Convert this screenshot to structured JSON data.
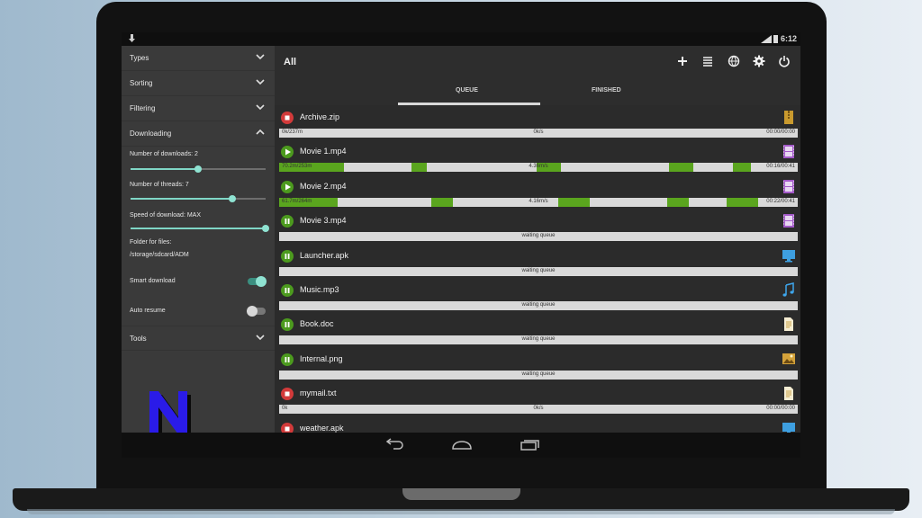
{
  "statusbar": {
    "time": "6:12"
  },
  "sidebar": {
    "sections": [
      {
        "label": "Types"
      },
      {
        "label": "Sorting"
      },
      {
        "label": "Filtering"
      },
      {
        "label": "Downloading"
      }
    ],
    "downloads_label": "Number of downloads: 2",
    "downloads_level": 0.5,
    "threads_label": "Number of threads: 7",
    "threads_level": 0.75,
    "speed_label": "Speed of download: MAX",
    "speed_level": 1.0,
    "folder_label": "Folder for files:",
    "folder_path": "/storage/sdcard/ADM",
    "smart_label": "Smart download",
    "smart_on": true,
    "auto_label": "Auto resume",
    "auto_on": false,
    "tools_label": "Tools"
  },
  "header": {
    "title": "All"
  },
  "tabs": {
    "queue": "QUEUE",
    "finished": "FINISHED"
  },
  "accent": "#5aa51e",
  "downloads": [
    {
      "name": "Archive.zip",
      "state": "stop",
      "icon": "zip-icon",
      "left": "0k/237m",
      "center": "0k/s",
      "right": "00:00/00:00"
    },
    {
      "name": "Movie 1.mp4",
      "state": "play",
      "icon": "video-icon",
      "left": "70.2m/253m",
      "center": "4.36m/s",
      "right": "00:16/00:41"
    },
    {
      "name": "Movie 2.mp4",
      "state": "play",
      "icon": "video-icon",
      "left": "61.7m/264m",
      "center": "4.16m/s",
      "right": "00:22/00:41"
    },
    {
      "name": "Movie 3.mp4",
      "state": "pause",
      "icon": "video-icon",
      "center": "waiting queue"
    },
    {
      "name": "Launcher.apk",
      "state": "pause",
      "icon": "app-icon",
      "center": "waiting queue"
    },
    {
      "name": "Music.mp3",
      "state": "pause",
      "icon": "music-icon",
      "center": "waiting queue"
    },
    {
      "name": "Book.doc",
      "state": "pause",
      "icon": "document-icon",
      "center": "waiting queue"
    },
    {
      "name": "Internal.png",
      "state": "pause",
      "icon": "image-icon",
      "center": "waiting queue"
    },
    {
      "name": "mymail.txt",
      "state": "stop",
      "icon": "document-icon",
      "left": "0k",
      "center": "0k/s",
      "right": "00:00/00:00"
    },
    {
      "name": "weather.apk",
      "state": "stop",
      "icon": "app-icon"
    }
  ]
}
